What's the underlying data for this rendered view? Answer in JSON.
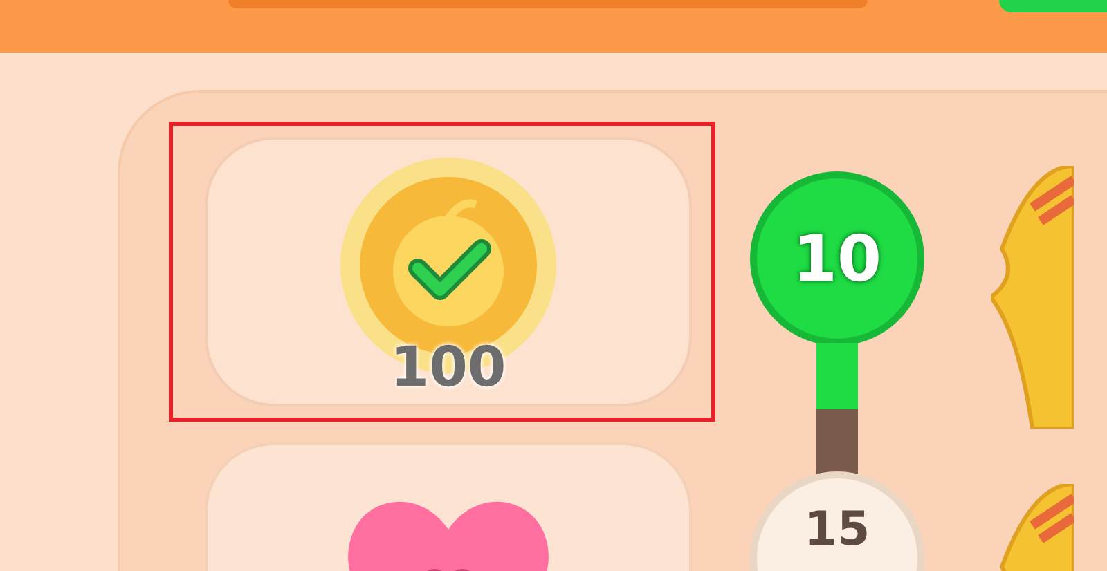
{
  "rewards": [
    {
      "kind": "coin",
      "amount": "100",
      "claimed": true,
      "highlighted": true
    },
    {
      "kind": "heart",
      "highlighted": false
    }
  ],
  "milestones": [
    {
      "label": "10",
      "reached": true,
      "level": 0.5
    },
    {
      "label": "15",
      "reached": false
    }
  ]
}
